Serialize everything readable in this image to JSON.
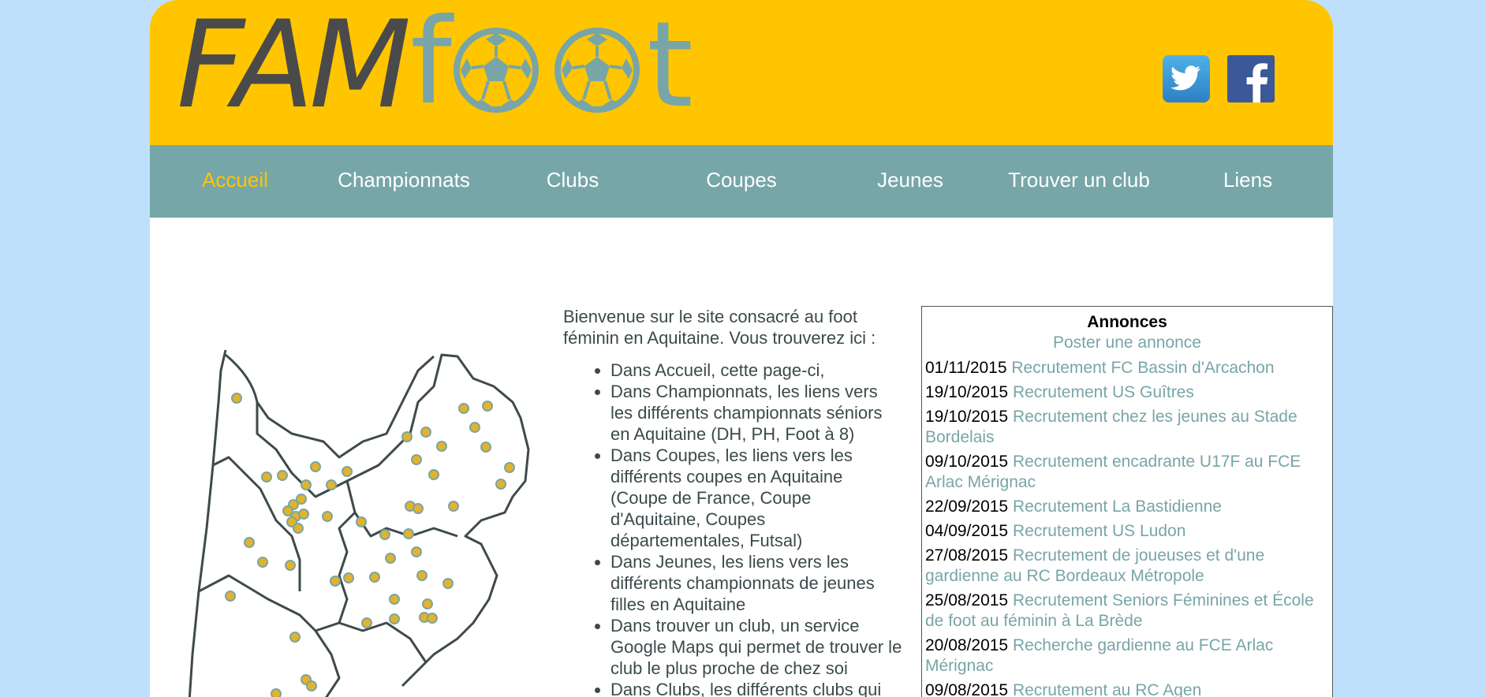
{
  "header": {
    "logo_text_dark": "FAM",
    "logo_text_f": "f",
    "logo_text_t": "t",
    "social": [
      "twitter-icon",
      "facebook-icon"
    ]
  },
  "nav": {
    "items": [
      {
        "label": "Accueil",
        "active": true
      },
      {
        "label": "Championnats",
        "active": false
      },
      {
        "label": "Clubs",
        "active": false
      },
      {
        "label": "Coupes",
        "active": false
      },
      {
        "label": "Jeunes",
        "active": false
      },
      {
        "label": "Trouver un club",
        "active": false
      },
      {
        "label": "Liens",
        "active": false
      }
    ]
  },
  "intro": {
    "paragraph": "Bienvenue sur le site consacré au foot féminin en Aquitaine. Vous trouverez ici :",
    "bullets": [
      "Dans Accueil, cette page-ci,",
      "Dans Championnats, les liens vers les différents championnats séniors en Aquitaine (DH, PH, Foot à 8)",
      "Dans Coupes, les liens vers les différents coupes en Aquitaine (Coupe de France, Coupe d'Aquitaine, Coupes départementales, Futsal)",
      "Dans Jeunes, les liens vers les différents championnats de jeunes filles en Aquitaine",
      "Dans trouver un club, un service Google Maps qui permet de trouver le club le plus proche de chez soi",
      "Dans Clubs, les différents clubs qui"
    ]
  },
  "annonces": {
    "title": "Annonces",
    "post_link": "Poster une annonce",
    "items": [
      {
        "date": "01/11/2015",
        "text": "Recrutement FC Bassin d'Arcachon"
      },
      {
        "date": "19/10/2015",
        "text": "Recrutement US Guîtres"
      },
      {
        "date": "19/10/2015",
        "text": "Recrutement chez les jeunes au Stade Bordelais"
      },
      {
        "date": "09/10/2015",
        "text": "Recrutement encadrante U17F au FCE Arlac Mérignac"
      },
      {
        "date": "22/09/2015",
        "text": "Recrutement La Bastidienne"
      },
      {
        "date": "04/09/2015",
        "text": "Recrutement US Ludon"
      },
      {
        "date": "27/08/2015",
        "text": "Recrutement de joueuses et d'une gardienne au RC Bordeaux Métropole"
      },
      {
        "date": "25/08/2015",
        "text": "Recrutement Seniors Féminines et École de foot au féminin à La Brède"
      },
      {
        "date": "20/08/2015",
        "text": "Recherche gardienne au FCE Arlac Mérignac"
      },
      {
        "date": "09/08/2015",
        "text": "Recrutement au RC Agen"
      }
    ]
  },
  "colors": {
    "background": "#bfe0fd",
    "header": "#ffc501",
    "nav": "#76a6a8",
    "accent": "#78a5a7",
    "logo_dark": "#4a4a4a"
  }
}
